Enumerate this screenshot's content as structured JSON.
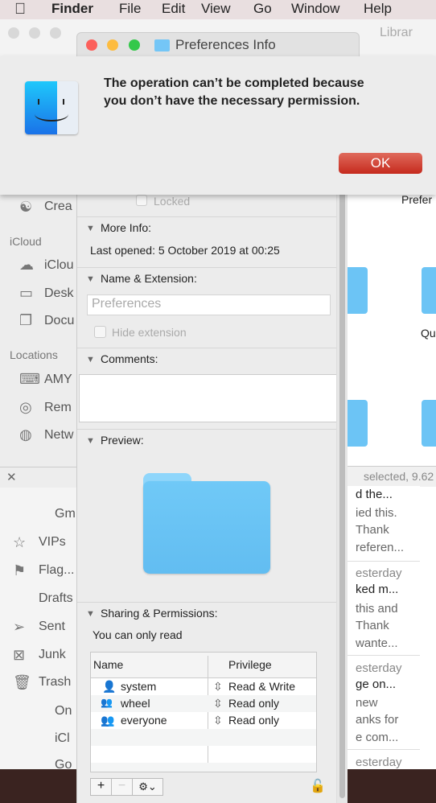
{
  "menubar": {
    "apple": "",
    "items": [
      "Finder",
      "File",
      "Edit",
      "View",
      "Go",
      "Window",
      "Help"
    ]
  },
  "finder": {
    "path_title": "Librar",
    "sidebar": {
      "items_top": [
        "Crea"
      ],
      "icloud_header": "iCloud",
      "icloud_items": [
        "iClou",
        "Desk",
        "Docu"
      ],
      "locations_header": "Locations",
      "location_items": [
        "AMY",
        "Rem",
        "Netw"
      ]
    },
    "content": {
      "labels": [
        "Prefer",
        "Qu"
      ],
      "status": "selected, 9.62"
    }
  },
  "mail": {
    "sidebar": [
      "Gm",
      "VIPs",
      "Flag...",
      "Drafts",
      "Sent",
      "Junk",
      "Trash",
      "On",
      "iCl",
      "Go"
    ],
    "list": [
      [
        "d the...",
        "ied this.",
        "Thank",
        "referen..."
      ],
      [
        "esterday",
        "ked m...",
        "this and",
        "Thank",
        "wante..."
      ],
      [
        "esterday",
        "ge on...",
        "new",
        "anks for",
        "e com..."
      ],
      [
        "esterday"
      ]
    ]
  },
  "info": {
    "title": "Preferences Info",
    "locked_label": "Locked",
    "more_info": {
      "title": "More Info:",
      "last_opened": "Last opened: 5 October 2019 at 00:25"
    },
    "name_ext": {
      "title": "Name & Extension:",
      "name_value": "Preferences",
      "hide_extension": "Hide extension"
    },
    "comments": {
      "title": "Comments:",
      "value": ""
    },
    "preview": {
      "title": "Preview:"
    },
    "sharing": {
      "title": "Sharing & Permissions:",
      "status": "You can only read",
      "col_name": "Name",
      "col_privilege": "Privilege",
      "rows": [
        {
          "name": "system",
          "privilege": "Read & Write",
          "icon": "user-icon"
        },
        {
          "name": "wheel",
          "privilege": "Read only",
          "icon": "group-icon"
        },
        {
          "name": "everyone",
          "privilege": "Read only",
          "icon": "everyone-icon"
        }
      ],
      "add": "+",
      "remove": "−",
      "gear": "⚙⌄"
    }
  },
  "alert": {
    "message_line1": "The operation can’t be completed because",
    "message_line2": "you don’t have the necessary permission.",
    "ok": "OK",
    "ok_color": "#c52a1d"
  }
}
